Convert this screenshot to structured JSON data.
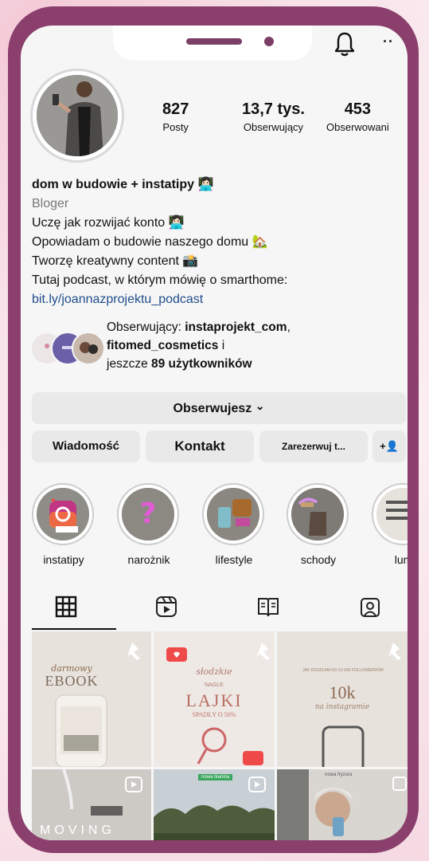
{
  "profile": {
    "stats": [
      {
        "value": "827",
        "label": "Posty"
      },
      {
        "value": "13,7 tys.",
        "label": "Obserwujący"
      },
      {
        "value": "453",
        "label": "Obserwowani"
      }
    ],
    "name": "dom w budowie + instatipy 👩🏻‍💻",
    "category": "Bloger",
    "bio_lines": [
      "Uczę jak rozwijać konto 👩🏻‍💻",
      "Opowiadam o budowie naszego domu 🏡",
      "Tworzę kreatywny content 📸",
      "Tutaj podcast, w którym mówię o smarthome:"
    ],
    "link": "bit.ly/joannazprojektu_podcast"
  },
  "followed_by": {
    "prefix": "Obserwujący: ",
    "user1": "instaprojekt_com",
    "sep": ",",
    "user2": "fitomed_cosmetics",
    "connector": " i",
    "line3_prefix": "jeszcze ",
    "line3_bold": "89 użytkowników"
  },
  "buttons": {
    "follow": "Obserwujesz",
    "follow_chevron": "⌄",
    "message": "Wiadomość",
    "contact": "Kontakt",
    "book": "Zarezerwuj t...",
    "add_user": "+👤"
  },
  "highlights": [
    {
      "label": "instatipy"
    },
    {
      "label": "narożnik"
    },
    {
      "label": "lifestyle"
    },
    {
      "label": "schody"
    },
    {
      "label": "lum"
    }
  ],
  "posts": {
    "p1_title_script": "darmowy",
    "p1_title": "EBOOK",
    "p2_script": "słodzkie",
    "p2_small": "NAGLE",
    "p2_title": "LAJKI",
    "p2_sub": "SPADŁY O 50%",
    "p3_small": "JAK DOSZŁAM DO 10 000 FOLLOWERSÓW",
    "p3_title": "10k",
    "p3_script": "na instagramie",
    "p4_text": "MOVING",
    "p5_tag": "nowa tkanina",
    "p6_tag": "nowa fryzura"
  },
  "colors": {
    "frame": "#8a3f6c",
    "accent_red": "#ef4a4a",
    "link": "#1f4d8c"
  }
}
